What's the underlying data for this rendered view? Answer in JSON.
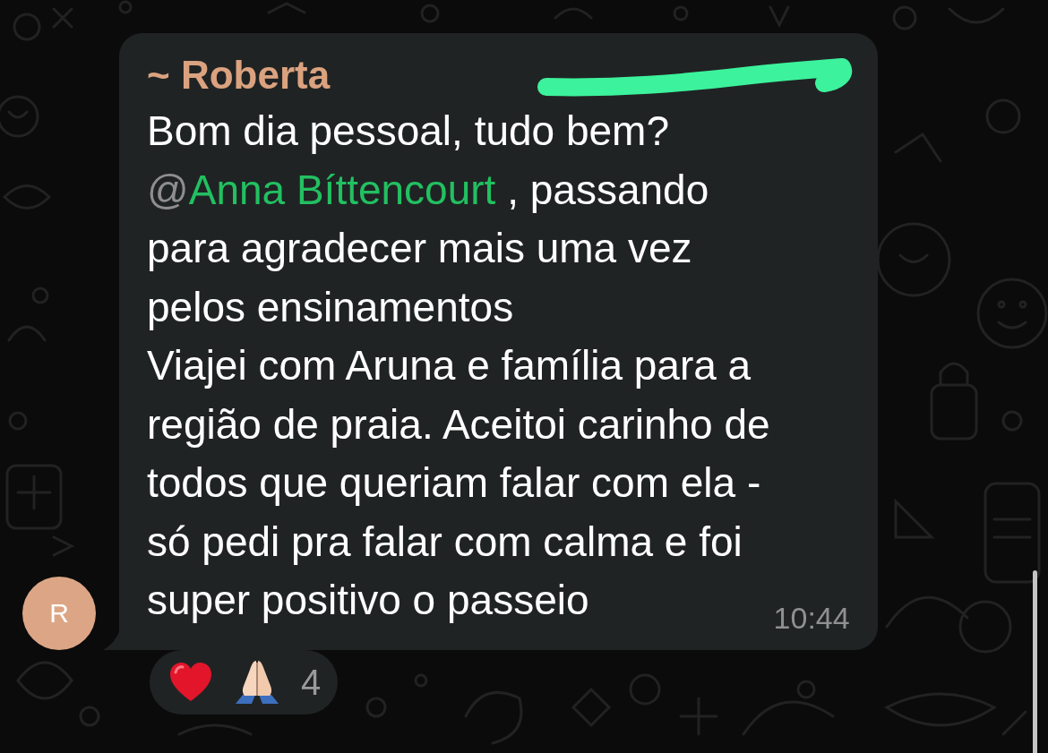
{
  "message": {
    "sender": "~ Roberta",
    "avatar": {
      "initial": "R"
    },
    "body": [
      {
        "kind": "text",
        "text": "Bom dia pessoal, tudo bem?\n"
      },
      {
        "kind": "mention",
        "prefix": "@",
        "name": "Anna Bíttencourt"
      },
      {
        "kind": "text",
        "text": " , passando\npara agradecer mais uma vez\npelos ensinamentos\nViajei com Aruna e família para a\nregião de praia. Aceitoi carinho de\ntodos que queriam falar com ela -\nsó pedi pra falar com calma e foi\nsuper positivo o passeio"
      }
    ],
    "time": "10:44",
    "reactions": {
      "emojis": [
        {
          "kind": "heart"
        },
        {
          "kind": "praying-hands"
        }
      ],
      "count": "4"
    }
  }
}
